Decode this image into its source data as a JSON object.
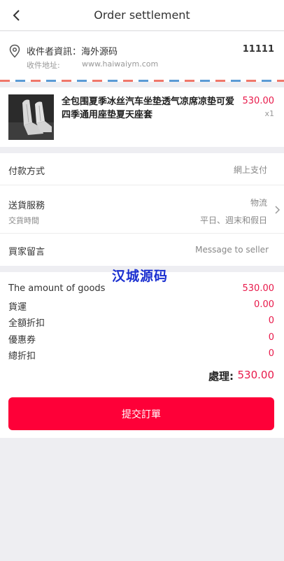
{
  "header": {
    "title": "Order settlement",
    "back_icon": "chevron-left-icon"
  },
  "address": {
    "recipient_label": "收件者資訊：",
    "recipient_name": "海外源码",
    "phone": "11111",
    "address_label": "收件地址:",
    "address_value": "www.haiwaiym.com",
    "stripe_colors": [
      "#f0776a",
      "#5b9bd5"
    ]
  },
  "product": {
    "title": "全包围夏季冰丝汽车坐垫透气凉席凉垫可爱四季通用座垫夏天座套",
    "price": "530.00",
    "quantity": "x1"
  },
  "options": {
    "payment": {
      "label": "付款方式",
      "value": "網上支付"
    },
    "delivery": {
      "label": "送貨服務",
      "value": "物流",
      "time_label": "交貨時間",
      "time_value": "平日、週末和假日"
    },
    "message": {
      "label": "買家留言",
      "placeholder": "Message to seller"
    }
  },
  "watermark": "汉城源码",
  "summary": {
    "rows": [
      {
        "label": "The amount of goods",
        "value": "530.00"
      },
      {
        "label": "貨運",
        "value": "0.00"
      },
      {
        "label": "全額折扣",
        "value": "0"
      },
      {
        "label": "優惠券",
        "value": "0"
      },
      {
        "label": "總折扣",
        "value": "0"
      }
    ],
    "total_label": "處理:",
    "total_value": "530.00"
  },
  "submit": {
    "label": "提交訂單"
  },
  "colors": {
    "accent": "#fe0038",
    "price": "#e8194a",
    "background": "#eeeef2"
  }
}
